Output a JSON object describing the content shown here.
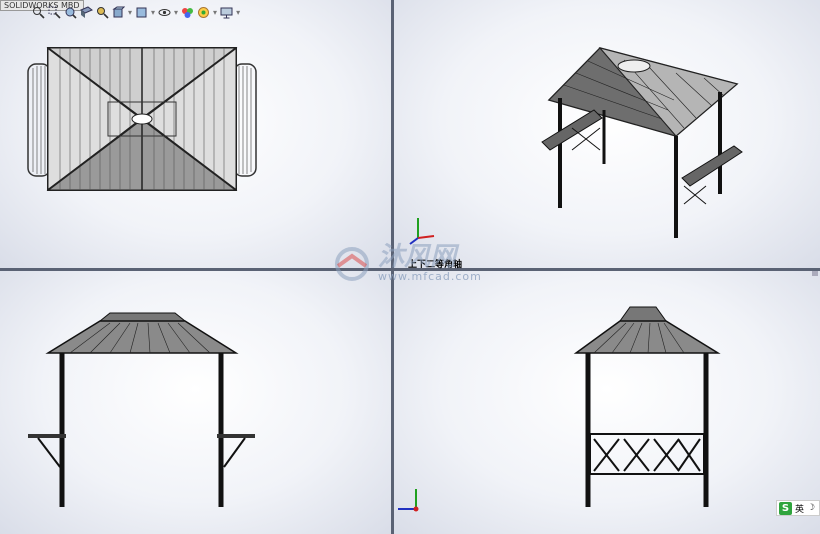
{
  "app": {
    "tag": "SOLIDWORKS MBD"
  },
  "toolbar": {
    "icons": [
      "zoom-to-fit-icon",
      "zoom-area-icon",
      "previous-view-icon",
      "section-view-icon",
      "dynamic-annotation-icon",
      "view-orientation-icon",
      "display-style-icon",
      "hide-show-items-icon",
      "edit-appearance-icon",
      "apply-scene-icon",
      "view-settings-icon"
    ]
  },
  "viewports": {
    "top": "top-view",
    "iso": "isometric-view",
    "front": "front-view",
    "right": "right-view"
  },
  "view_label": "上下二等角轴",
  "watermark": {
    "title": "沐风网",
    "url": "www.mfcad.com"
  },
  "ime": {
    "logo": "S",
    "lang": "英",
    "mode": "☽"
  },
  "axes": {
    "x": "X",
    "y": "Y",
    "z": "Z"
  },
  "colors": {
    "divider": "#5a6274",
    "axis_x": "#d02020",
    "axis_y": "#20a020",
    "axis_z": "#2030c0"
  }
}
